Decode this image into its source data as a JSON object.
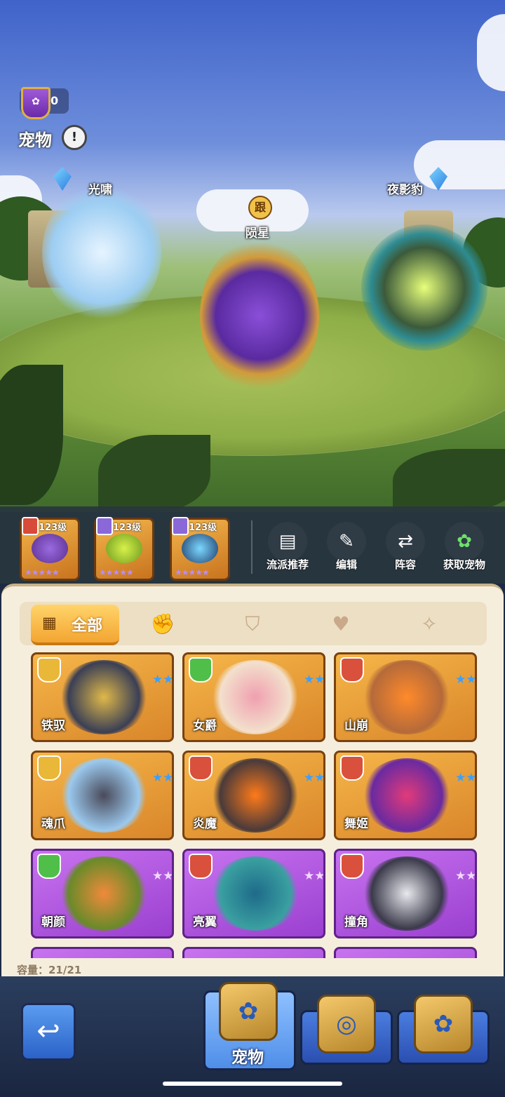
{
  "header": {
    "trophy_count": "0",
    "title": "宠物",
    "info_glyph": "!"
  },
  "arena": {
    "pets": [
      {
        "name": "光啸",
        "crystal": true
      },
      {
        "name": "陨星",
        "follow_badge": "跟"
      },
      {
        "name": "夜影豹",
        "crystal": true
      }
    ]
  },
  "team": {
    "slots": [
      {
        "level": "123级",
        "stars": "★★★★★"
      },
      {
        "level": "123级",
        "stars": "★★★★★"
      },
      {
        "level": "123级",
        "stars": "★★★★★"
      }
    ],
    "actions": [
      {
        "label": "流派推荐",
        "icon": "scroll-icon",
        "glyph": "▤"
      },
      {
        "label": "编辑",
        "icon": "pencil-icon",
        "glyph": "✎"
      },
      {
        "label": "阵容",
        "icon": "swap-icon",
        "glyph": "⇄"
      },
      {
        "label": "获取宠物",
        "icon": "paw-icon",
        "glyph": "✿"
      }
    ]
  },
  "filter": {
    "all_label": "全部",
    "all_glyph": "▦",
    "tab_icons": [
      {
        "icon": "attack-icon",
        "glyph": "✊"
      },
      {
        "icon": "shield-icon",
        "glyph": "⛉"
      },
      {
        "icon": "heart-icon",
        "glyph": "♥"
      },
      {
        "icon": "magic-icon",
        "glyph": "✧"
      }
    ]
  },
  "pets": [
    {
      "name": "铁驭",
      "rarity": "gold",
      "role_color": "#e9b838"
    },
    {
      "name": "女爵",
      "rarity": "gold",
      "role_color": "#4fbf4a"
    },
    {
      "name": "山崩",
      "rarity": "gold",
      "role_color": "#d9503c"
    },
    {
      "name": "魂爪",
      "rarity": "gold",
      "role_color": "#e9b838"
    },
    {
      "name": "炎魔",
      "rarity": "gold",
      "role_color": "#d9503c"
    },
    {
      "name": "舞姬",
      "rarity": "gold",
      "role_color": "#d9503c"
    },
    {
      "name": "朝颜",
      "rarity": "purple",
      "role_color": "#4fbf4a"
    },
    {
      "name": "亮翼",
      "rarity": "purple",
      "role_color": "#d9503c"
    },
    {
      "name": "撞角",
      "rarity": "purple",
      "role_color": "#d9503c"
    }
  ],
  "capacity": "容量：21/21",
  "nav": {
    "back_glyph": "↩",
    "active_label": "宠物",
    "paw_glyph": "✿",
    "swirl_glyph": "◎"
  }
}
